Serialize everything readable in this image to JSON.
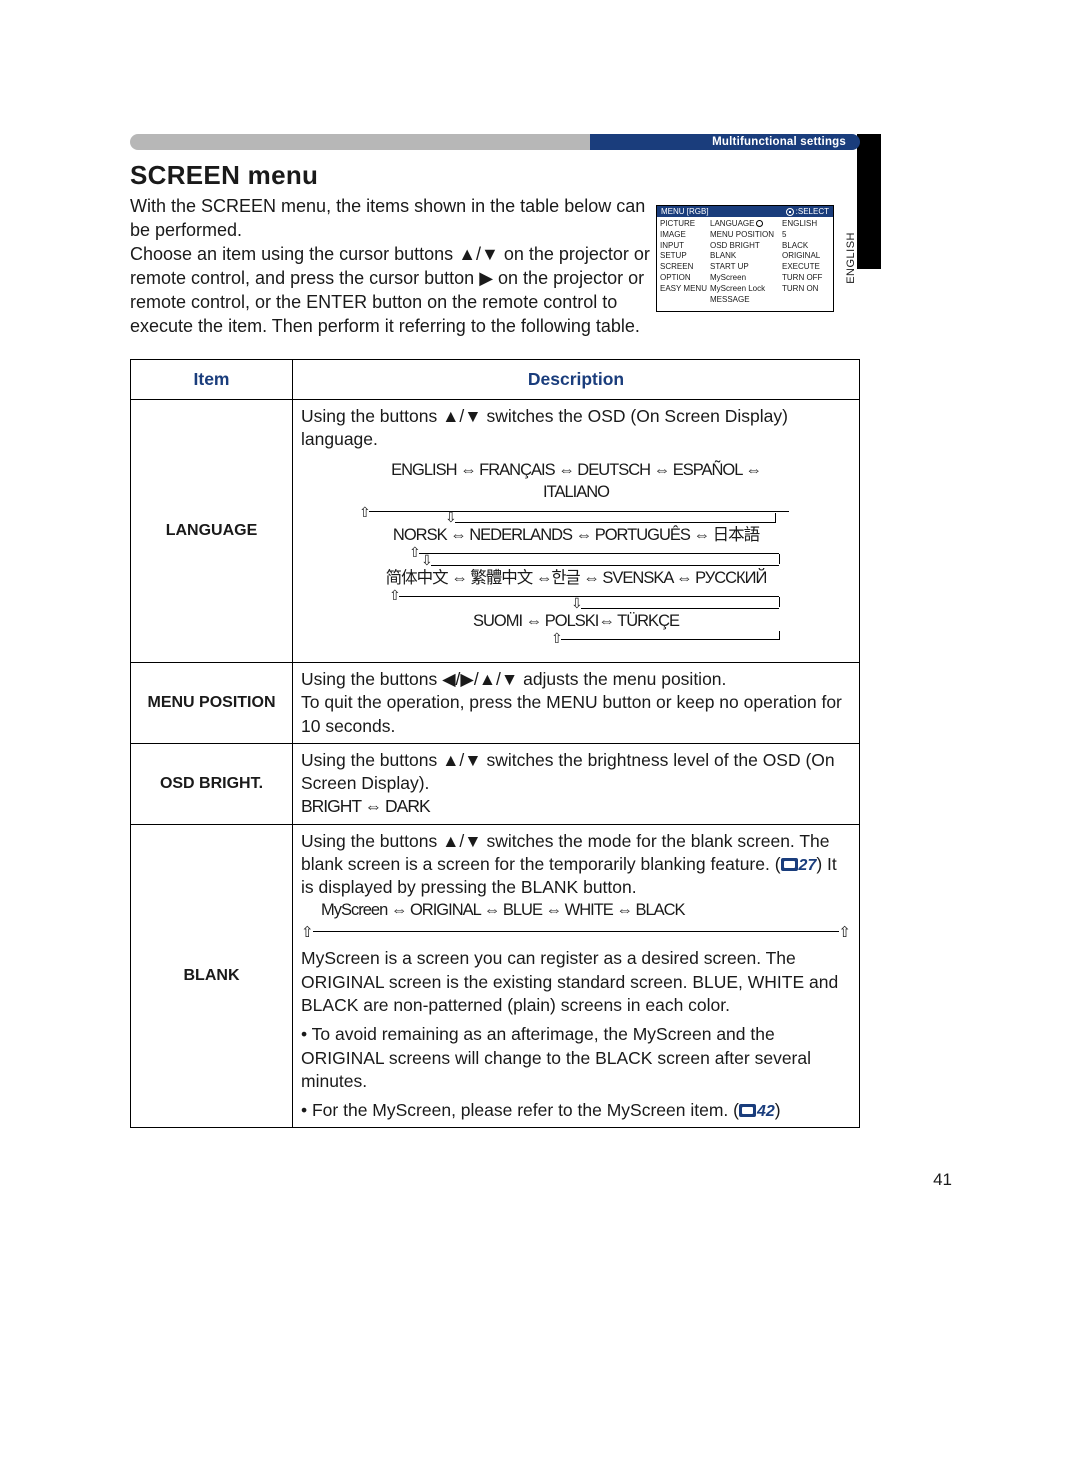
{
  "header": {
    "section_label": "Multifunctional settings"
  },
  "sidetab": {
    "language_vert": "ENGLISH"
  },
  "title": "SCREEN menu",
  "intro": {
    "p1": "With the SCREEN menu, the items shown in the table below can be performed.",
    "p2a": "Choose an item using the cursor buttons ",
    "p2_arrows": "▲/▼",
    "p2b": " on the projector or remote control, and press the cursor button ",
    "p2_right": "▶",
    "p2c": " on the projector or remote control, or the ENTER button on the remote control to execute the item. Then perform it referring to the following table."
  },
  "osd": {
    "menu_title_left": "MENU [RGB]",
    "menu_title_right": ":SELECT",
    "col1": [
      "PICTURE",
      "IMAGE",
      "INPUT",
      "SETUP",
      "SCREEN",
      "OPTION",
      "EASY MENU"
    ],
    "col2": [
      "LANGUAGE",
      "MENU POSITION",
      "OSD BRIGHT",
      "BLANK",
      "START UP",
      "MyScreen",
      "MyScreen Lock",
      "MESSAGE"
    ],
    "col3": [
      "ENGLISH",
      "",
      "5",
      "BLACK",
      "ORIGINAL",
      "EXECUTE",
      "TURN OFF",
      "TURN ON"
    ]
  },
  "table": {
    "head_item": "Item",
    "head_desc": "Description",
    "rows": {
      "language": {
        "item": "LANGUAGE",
        "d1a": "Using the buttons ",
        "d1_arrows": "▲/▼",
        "d1b": " switches the OSD (On Screen Display) language.",
        "flow_r1": "ENGLISH ⇔ FRANÇAIS ⇔ DEUTSCH ⇔ ESPAÑOL ⇔ ITALIANO",
        "flow_r2": "NORSK ⇔ NEDERLANDS ⇔ PORTUGUÊS ⇔ 日本語",
        "flow_r3": "简体中文 ⇔ 繁體中文 ⇔한글 ⇔ SVENSKA ⇔ РУССКИЙ",
        "flow_r4": "SUOMI ⇔ POLSKI⇔ TÜRKÇE"
      },
      "menu_position": {
        "item": "MENU POSITION",
        "d1a": "Using the buttons ",
        "d1_arrows": "◀/▶/▲/▼",
        "d1b": " adjusts the menu position.",
        "d2": "To quit the operation, press the MENU button or keep no operation for 10 seconds."
      },
      "osd_bright": {
        "item": "OSD BRIGHT.",
        "d1a": "Using the buttons ",
        "d1_arrows": "▲/▼",
        "d1b": " switches the brightness level of the OSD (On Screen Display).",
        "d2": "BRIGHT ⇔ DARK"
      },
      "blank": {
        "item": "BLANK",
        "p1a": "Using the buttons ",
        "p1_arrows": "▲/▼",
        "p1b": " switches the mode for the blank screen. The blank screen is a screen for the temporarily blanking feature. (",
        "p1_ref": "27",
        "p1c": ") It is displayed by pressing the BLANK button.",
        "flow": "MyScreen ⇔ ORIGINAL ⇔ BLUE ⇔ WHITE ⇔ BLACK",
        "p2": "MyScreen is a screen you can register as a desired screen. The ORIGINAL screen is the existing standard screen. BLUE, WHITE and BLACK are non-patterned (plain) screens in each color.",
        "p3": "• To avoid remaining as an afterimage, the MyScreen and the ORIGINAL screens will change to the BLACK screen after several minutes.",
        "p4a": "• For the MyScreen, please refer to the MyScreen item. (",
        "p4_ref": "42",
        "p4b": ")"
      }
    }
  },
  "page_number": "41"
}
